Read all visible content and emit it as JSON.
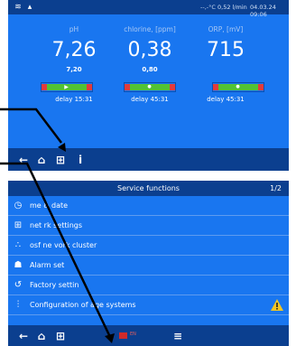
{
  "screen1": {
    "status": {
      "temperature": "--,-°C",
      "flow": "0,52 l/min",
      "datetime": "04.03.24 09:06",
      "left_icons": [
        "pool-icon",
        "swimmer-icon"
      ]
    },
    "columns": [
      {
        "label": "pH",
        "value": "7,26",
        "setpoint": "7,20",
        "delay": "delay 15:31",
        "marker": "triangle"
      },
      {
        "label": "chlorine, [ppm]",
        "value": "0,38",
        "setpoint": "0,80",
        "delay": "delay 45:31",
        "marker": "dot"
      },
      {
        "label": "ORP, [mV]",
        "value": "715",
        "setpoint": "",
        "delay": "delay 45:31",
        "marker": "dot"
      }
    ],
    "nav_icons": [
      "back-arrow-icon",
      "home-icon",
      "grid-icon",
      "info-icon"
    ]
  },
  "screen2": {
    "title": "Service functions",
    "page": "1/2",
    "menu": [
      {
        "icon": "clock-icon",
        "label": "me & date"
      },
      {
        "icon": "network-icon",
        "label": "net rk settings"
      },
      {
        "icon": "share-icon",
        "label": "osf ne vork cluster"
      },
      {
        "icon": "siren-icon",
        "label": "Alarm set"
      },
      {
        "icon": "reset-icon",
        "label": "Factory settin"
      },
      {
        "icon": "sliders-icon",
        "label": "Configuration of age systems",
        "warning": true
      }
    ],
    "nav_icons": [
      "back-arrow-icon",
      "home-icon",
      "grid-icon",
      "flag-icon",
      "list-icon"
    ],
    "flag_label": "EN"
  },
  "colors": {
    "screen_blue": "#1976f0",
    "bar_dark": "#0b3f8f",
    "ok_green": "#52c234",
    "alarm_red": "#e23b3b",
    "warning_yellow": "#f3c623"
  }
}
